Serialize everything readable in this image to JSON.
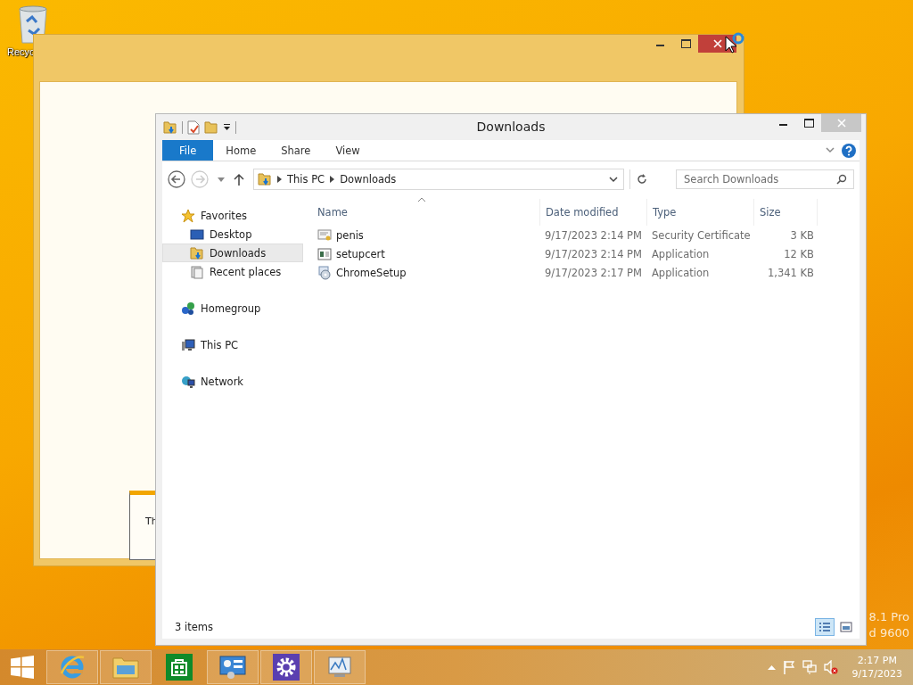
{
  "desktop": {
    "icons": [
      {
        "label": "Recyc"
      }
    ],
    "watermark": [
      "8.1 Pro",
      "d 9600"
    ]
  },
  "back_window": {
    "dialog_text": "Th"
  },
  "explorer": {
    "title": "Downloads",
    "ribbon_tabs": [
      {
        "label": "File",
        "kind": "file"
      },
      {
        "label": "Home",
        "kind": "tab"
      },
      {
        "label": "Share",
        "kind": "tab"
      },
      {
        "label": "View",
        "kind": "tab"
      }
    ],
    "breadcrumbs": [
      "This PC",
      "Downloads"
    ],
    "search": {
      "placeholder": "Search Downloads"
    },
    "nav": [
      {
        "label": "Favorites",
        "children": [
          {
            "label": "Desktop",
            "selected": false
          },
          {
            "label": "Downloads",
            "selected": true
          },
          {
            "label": "Recent places",
            "selected": false
          }
        ]
      },
      {
        "label": "Homegroup"
      },
      {
        "label": "This PC"
      },
      {
        "label": "Network"
      }
    ],
    "columns": [
      {
        "label": "Name",
        "sorted": true
      },
      {
        "label": "Date modified",
        "sorted": false
      },
      {
        "label": "Type",
        "sorted": false
      },
      {
        "label": "Size",
        "sorted": false
      }
    ],
    "files": [
      {
        "name": "penis",
        "date": "9/17/2023 2:14 PM",
        "type": "Security Certificate",
        "size": "3 KB"
      },
      {
        "name": "setupcert",
        "date": "9/17/2023 2:14 PM",
        "type": "Application",
        "size": "12 KB"
      },
      {
        "name": "ChromeSetup",
        "date": "9/17/2023 2:17 PM",
        "type": "Application",
        "size": "1,341 KB"
      }
    ],
    "status": "3 items",
    "views": [
      {
        "selected": true
      },
      {
        "selected": false
      }
    ]
  },
  "taskbar": {
    "time": "2:17 PM",
    "date": "9/17/2023"
  }
}
